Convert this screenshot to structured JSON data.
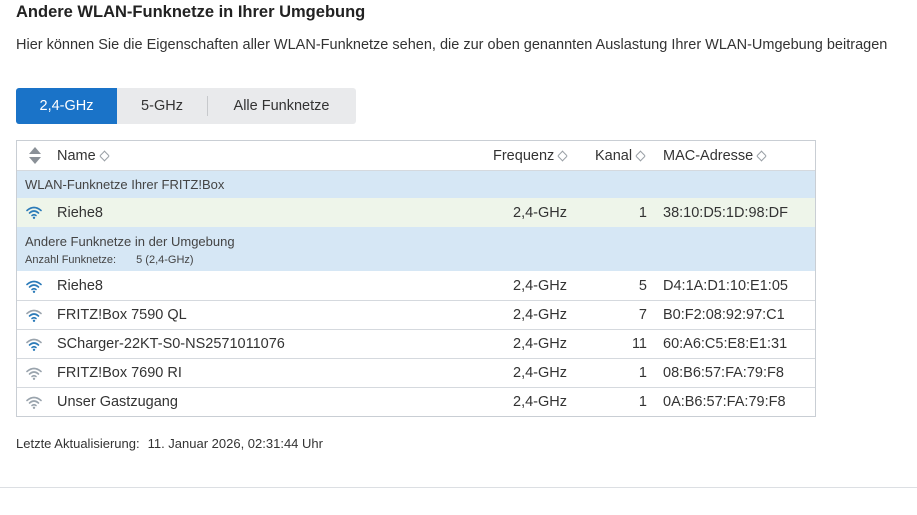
{
  "header": {
    "title": "Andere WLAN-Funknetze in Ihrer Umgebung",
    "description": "Hier können Sie die Eigenschaften aller WLAN-Funknetze sehen, die zur oben genannten Auslastung Ihrer WLAN-Umgebung beitragen"
  },
  "tabs": [
    {
      "label": "2,4-GHz",
      "active": true
    },
    {
      "label": "5-GHz",
      "active": false
    },
    {
      "label": "Alle Funknetze",
      "active": false
    }
  ],
  "table": {
    "columns": {
      "name": "Name",
      "freq": "Frequenz",
      "kanal": "Kanal",
      "mac": "MAC-Adresse"
    },
    "group_own": "WLAN-Funknetze Ihrer FRITZ!Box",
    "own_rows": [
      {
        "name": "Riehe8",
        "freq": "2,4-GHz",
        "kanal": "1",
        "mac": "38:10:D5:1D:98:DF",
        "signal": 4
      }
    ],
    "group_other": "Andere Funknetze in der Umgebung",
    "group_other_count_label": "Anzahl Funknetze:",
    "group_other_count_value": "5 (2,4-GHz)",
    "other_rows": [
      {
        "name": "Riehe8",
        "freq": "2,4-GHz",
        "kanal": "5",
        "mac": "D4:1A:D1:10:E1:05",
        "signal": 4
      },
      {
        "name": "FRITZ!Box 7590 QL",
        "freq": "2,4-GHz",
        "kanal": "7",
        "mac": "B0:F2:08:92:97:C1",
        "signal": 3
      },
      {
        "name": "SCharger-22KT-S0-NS2571011076",
        "freq": "2,4-GHz",
        "kanal": "11",
        "mac": "60:A6:C5:E8:E1:31",
        "signal": 3
      },
      {
        "name": "FRITZ!Box 7690 RI",
        "freq": "2,4-GHz",
        "kanal": "1",
        "mac": "08:B6:57:FA:79:F8",
        "signal": 2
      },
      {
        "name": "Unser Gastzugang",
        "freq": "2,4-GHz",
        "kanal": "1",
        "mac": "0A:B6:57:FA:79:F8",
        "signal": 2
      }
    ]
  },
  "footer": {
    "label": "Letzte Aktualisierung:",
    "value": "11. Januar 2026, 02:31:44 Uhr"
  },
  "colors": {
    "accent": "#1a73c8",
    "group_bg": "#d6e7f5",
    "own_row_bg": "#eef5ea",
    "wifi_strong": "#2b7ab8",
    "wifi_weak": "#9aa4ad"
  },
  "icons": {
    "sort": "sort-icon",
    "wifi": "wifi-signal-icon"
  }
}
